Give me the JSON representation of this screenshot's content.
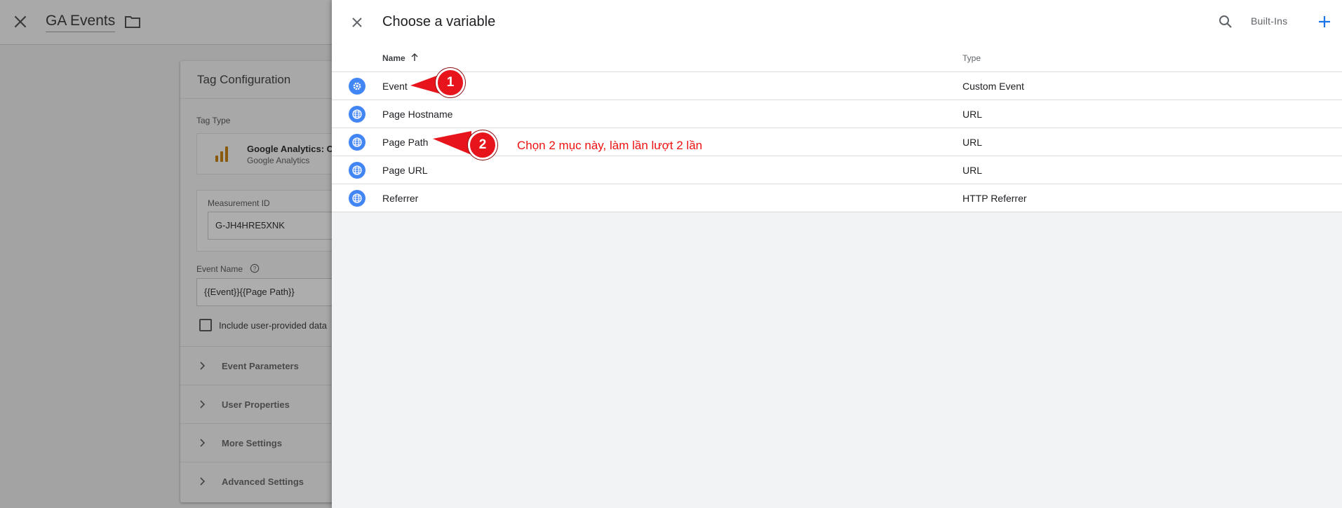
{
  "background": {
    "header": {
      "title": "GA Events",
      "close_icon": "close-icon",
      "folder_icon": "folder-icon"
    },
    "tag_config": {
      "title": "Tag Configuration",
      "tag_type_label": "Tag Type",
      "tag_type_name": "Google Analytics: C",
      "tag_type_sub": "Google Analytics",
      "measurement_id_label": "Measurement ID",
      "measurement_id_value": "G-JH4HRE5XNK",
      "event_name_label": "Event Name",
      "event_name_value": "{{Event}}{{Page Path}}",
      "checkbox_label": "Include user-provided data",
      "sections": [
        {
          "label": "Event Parameters"
        },
        {
          "label": "User Properties"
        },
        {
          "label": "More Settings"
        },
        {
          "label": "Advanced Settings"
        }
      ]
    }
  },
  "panel": {
    "title": "Choose a variable",
    "builtins_label": "Built-Ins",
    "columns": {
      "name": "Name",
      "type": "Type"
    },
    "rows": [
      {
        "name": "Event",
        "type": "Custom Event",
        "icon": "gear-icon"
      },
      {
        "name": "Page Hostname",
        "type": "URL",
        "icon": "globe-icon"
      },
      {
        "name": "Page Path",
        "type": "URL",
        "icon": "globe-icon"
      },
      {
        "name": "Page URL",
        "type": "URL",
        "icon": "globe-icon"
      },
      {
        "name": "Referrer",
        "type": "HTTP Referrer",
        "icon": "globe-icon"
      }
    ]
  },
  "annotations": {
    "badge1": "1",
    "badge2": "2",
    "note": "Chọn 2 mục này, làm lần lượt 2 lần"
  },
  "colors": {
    "accent": "#1a73e8",
    "icon_bg": "#4285f4",
    "annotation_red": "#e8141b"
  }
}
